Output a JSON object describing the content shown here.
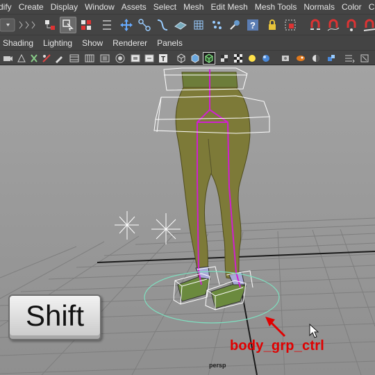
{
  "menu": [
    "dify",
    "Create",
    "Display",
    "Window",
    "Assets",
    "Select",
    "Mesh",
    "Edit Mesh",
    "Mesh Tools",
    "Normals",
    "Color",
    "C"
  ],
  "panel_menu": [
    "Shading",
    "Lighting",
    "Show",
    "Renderer",
    "Panels"
  ],
  "viewport": {
    "camera": "persp",
    "annotation": "body_grp_ctrl",
    "key_overlay": "Shift"
  },
  "colors": {
    "ui_bg": "#444444",
    "viewport_bg": "#9a9a9a",
    "mesh": "#7d7a38",
    "joint": "#d020d0",
    "control_curve": "#7ee0c0",
    "annotation": "#e10000"
  },
  "toolbar_icons": [
    "mode-dropdown",
    "select-tool",
    "lasso-tool",
    "paint-select",
    "move",
    "joint",
    "ik-handle",
    "smooth",
    "lattice",
    "cluster",
    "help",
    "lock",
    "snapshot",
    "magnet-grid",
    "magnet-curve",
    "magnet-point",
    "magnet-surface"
  ],
  "panel_icons": [
    "camera",
    "wireframe",
    "smooth-shade",
    "textured",
    "lights",
    "shadows",
    "ambient-occlusion",
    "resolution-gate",
    "grid",
    "isolate"
  ]
}
